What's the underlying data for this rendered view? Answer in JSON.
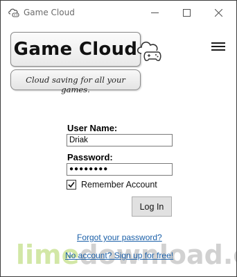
{
  "window": {
    "title": "Game Cloud",
    "app_icon": "cloud-controller-icon",
    "controls": [
      "minimize-icon",
      "maximize-icon",
      "close-icon"
    ]
  },
  "header": {
    "logo_text": "Game Cloud",
    "logo_icon": "cloud-controller-icon",
    "tagline": "Cloud saving for all your games.",
    "menu_icon": "hamburger-menu-icon"
  },
  "login_form": {
    "username_label": "User Name:",
    "username_value": "Driak",
    "password_label": "Password:",
    "password_value": "●●●●●●●●",
    "remember_label": "Remember Account",
    "remember_checked": true,
    "login_button": "Log In",
    "forgot_link": "Forgot your password?",
    "signup_link": "No account? Sign up for free!"
  },
  "watermark": {
    "part1": "lime",
    "part2": "download.com"
  }
}
